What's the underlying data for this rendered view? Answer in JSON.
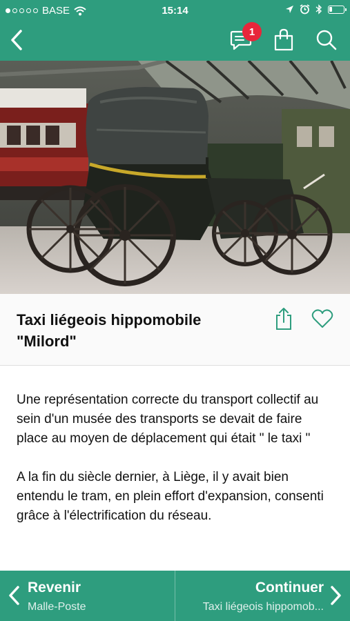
{
  "status_bar": {
    "carrier": "BASE",
    "signal_filled": 1,
    "signal_total": 5,
    "time": "15:14",
    "battery_level_fraction": 0.2
  },
  "nav": {
    "back_icon": "chevron-left-icon",
    "icons": [
      "chat-icon",
      "shopping-bag-icon",
      "search-icon"
    ],
    "chat_badge": "1",
    "badge_color": "#e8263a",
    "accent_color": "#2e9d7e"
  },
  "hero": {
    "icon": "photo",
    "subject": "horse-drawn carriage in museum hall"
  },
  "article": {
    "title": "Taxi liégeois hippomobile \"Milord\"",
    "paragraphs": [
      "Une représentation correcte du transport collectif au sein d'un musée des transports se devait de faire place au moyen de déplacement qui était \" le taxi \"",
      "A la fin du siècle dernier, à Liège, il y avait bien entendu le tram, en plein effort d'expansion, consenti grâce à l'électrification du réseau."
    ]
  },
  "footer": {
    "prev_label": "Revenir",
    "prev_sub": "Malle-Poste",
    "next_label": "Continuer",
    "next_sub": "Taxi liégeois hippomob..."
  }
}
